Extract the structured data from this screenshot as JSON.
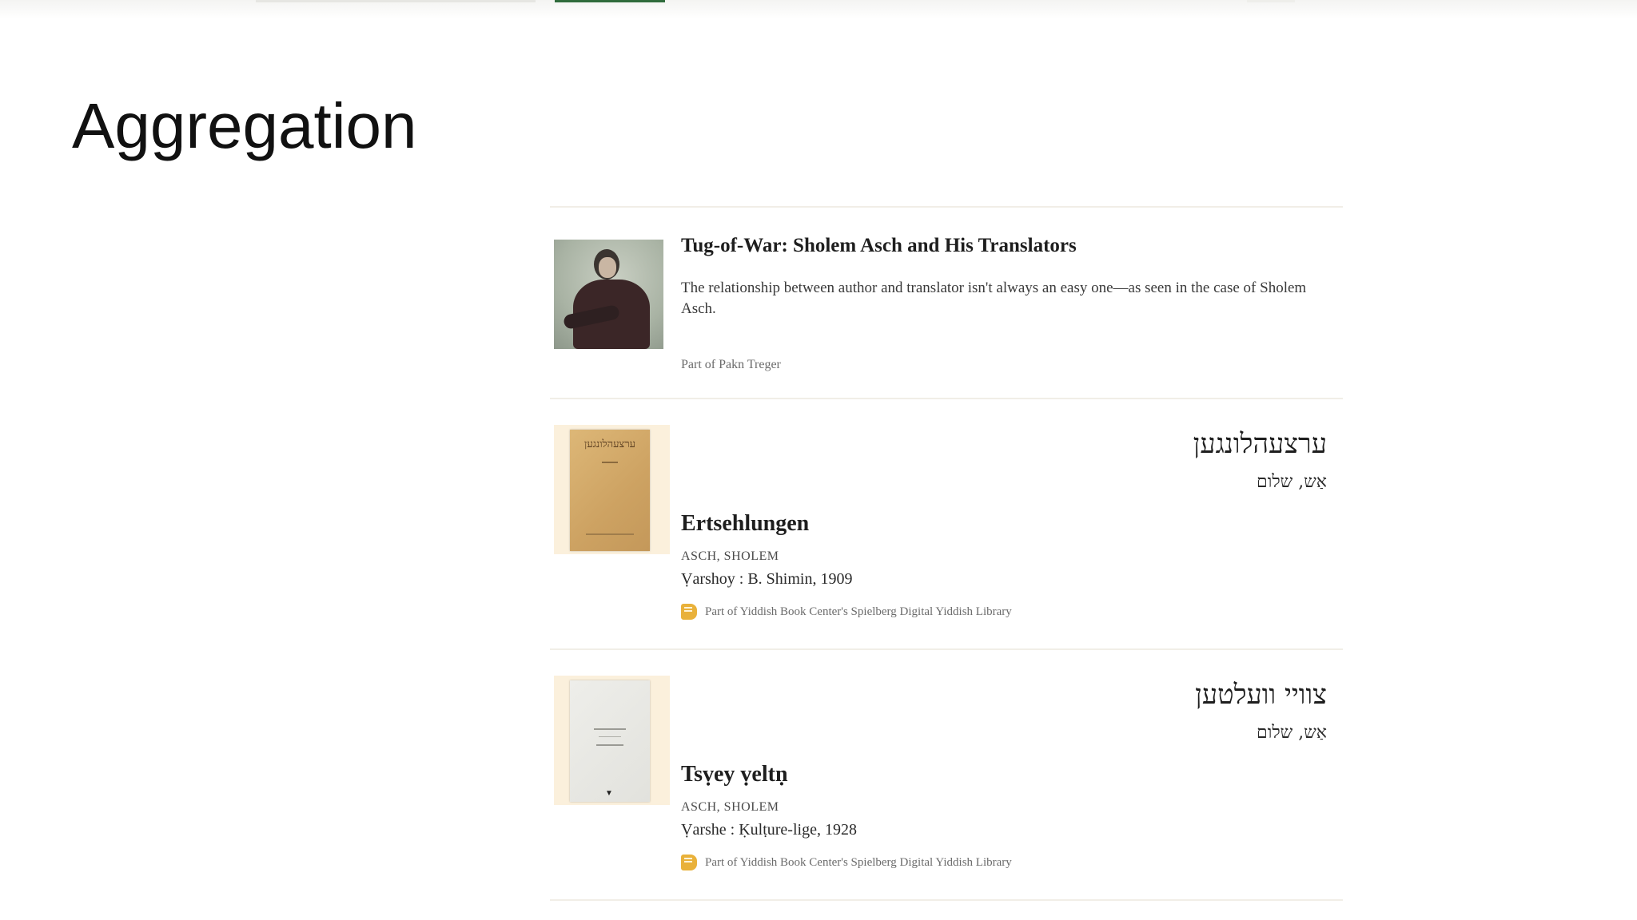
{
  "slide": {
    "title": "Aggregation"
  },
  "results": {
    "article": {
      "title": "Tug-of-War: Sholem Asch and His Translators",
      "description": "The relationship between author and translator isn't always an easy one—as seen in the case of Sholem Asch.",
      "part_of": "Part of Pakn Treger"
    },
    "books": [
      {
        "yiddish_title": "ערצעהלונגען",
        "yiddish_author": "אַש, שלום",
        "title": "Ertsehlungen",
        "author": "ASCH, SHOLEM",
        "imprint": "Ṿarshoy : B. Shimin, 1909",
        "collection": "Part of Yiddish Book Center's Spielberg Digital Yiddish Library",
        "cover_title": "ערצעהלונגען"
      },
      {
        "yiddish_title": "צוויי וועלטען",
        "yiddish_author": "אַש, שלום",
        "title": "Tsṿey ṿeltṇ",
        "author": "ASCH, SHOLEM",
        "imprint": "Ṿarshe : Ḳulṭure-lige, 1928",
        "collection": "Part of Yiddish Book Center's Spielberg Digital Yiddish Library"
      }
    ]
  },
  "icons": {
    "collection_icon": "book-icon",
    "collection_icon_color": "#e9b13a"
  }
}
